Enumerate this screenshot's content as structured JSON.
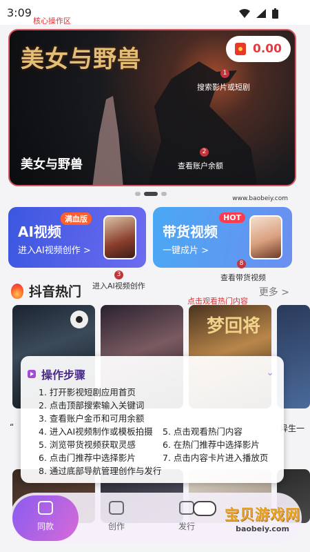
{
  "status": {
    "time": "3:09"
  },
  "annotations": {
    "core_area": "核心操作区",
    "search_label": "搜索影片或短剧",
    "balance_label": "查看账户余额",
    "ai_create_label": "进入AI视频创作",
    "goods_label": "查看带货视频",
    "hot_label": "点击观看热门内容",
    "num1": "1",
    "num2": "2",
    "num3": "3",
    "num4": "8"
  },
  "hero": {
    "logo_text": "美女与野兽",
    "caption": "美女与野兽"
  },
  "coin": {
    "value": "0.00"
  },
  "url_watermark": "www.baobeiy.com",
  "cards": {
    "ai": {
      "title": "AI视频",
      "badge": "满血版",
      "sub": "进入AI视频创作 >"
    },
    "goods": {
      "title": "带货视频",
      "badge": "HOT",
      "sub": "一键成片 >"
    }
  },
  "hot": {
    "title": "抖音热门",
    "more": "更多 >",
    "poster3_text": "梦回将"
  },
  "cutoff": {
    "left": "“",
    "right": "异生一"
  },
  "steps": {
    "title": "操作步骤",
    "items": [
      "1. 打开影视短剧应用首页",
      "2. 点击顶部搜索输入关键词",
      "3. 查看账户金币和可用余额",
      "4. 进入AI视频制作或模板拍摄",
      "5. 点击观看热门内容",
      "5. 浏览带货视频获取灵感",
      "6. 在热门推荐中选择影片",
      "6. 点击门推荐中选择影片",
      "7. 点击内容卡片进入播放页",
      "8. 通过底部导航管理创作与发行"
    ]
  },
  "nav": {
    "items": [
      "同款",
      "创作",
      "发行"
    ]
  },
  "watermark": {
    "big": "宝贝游戏网",
    "small": "baobeiy.com"
  }
}
